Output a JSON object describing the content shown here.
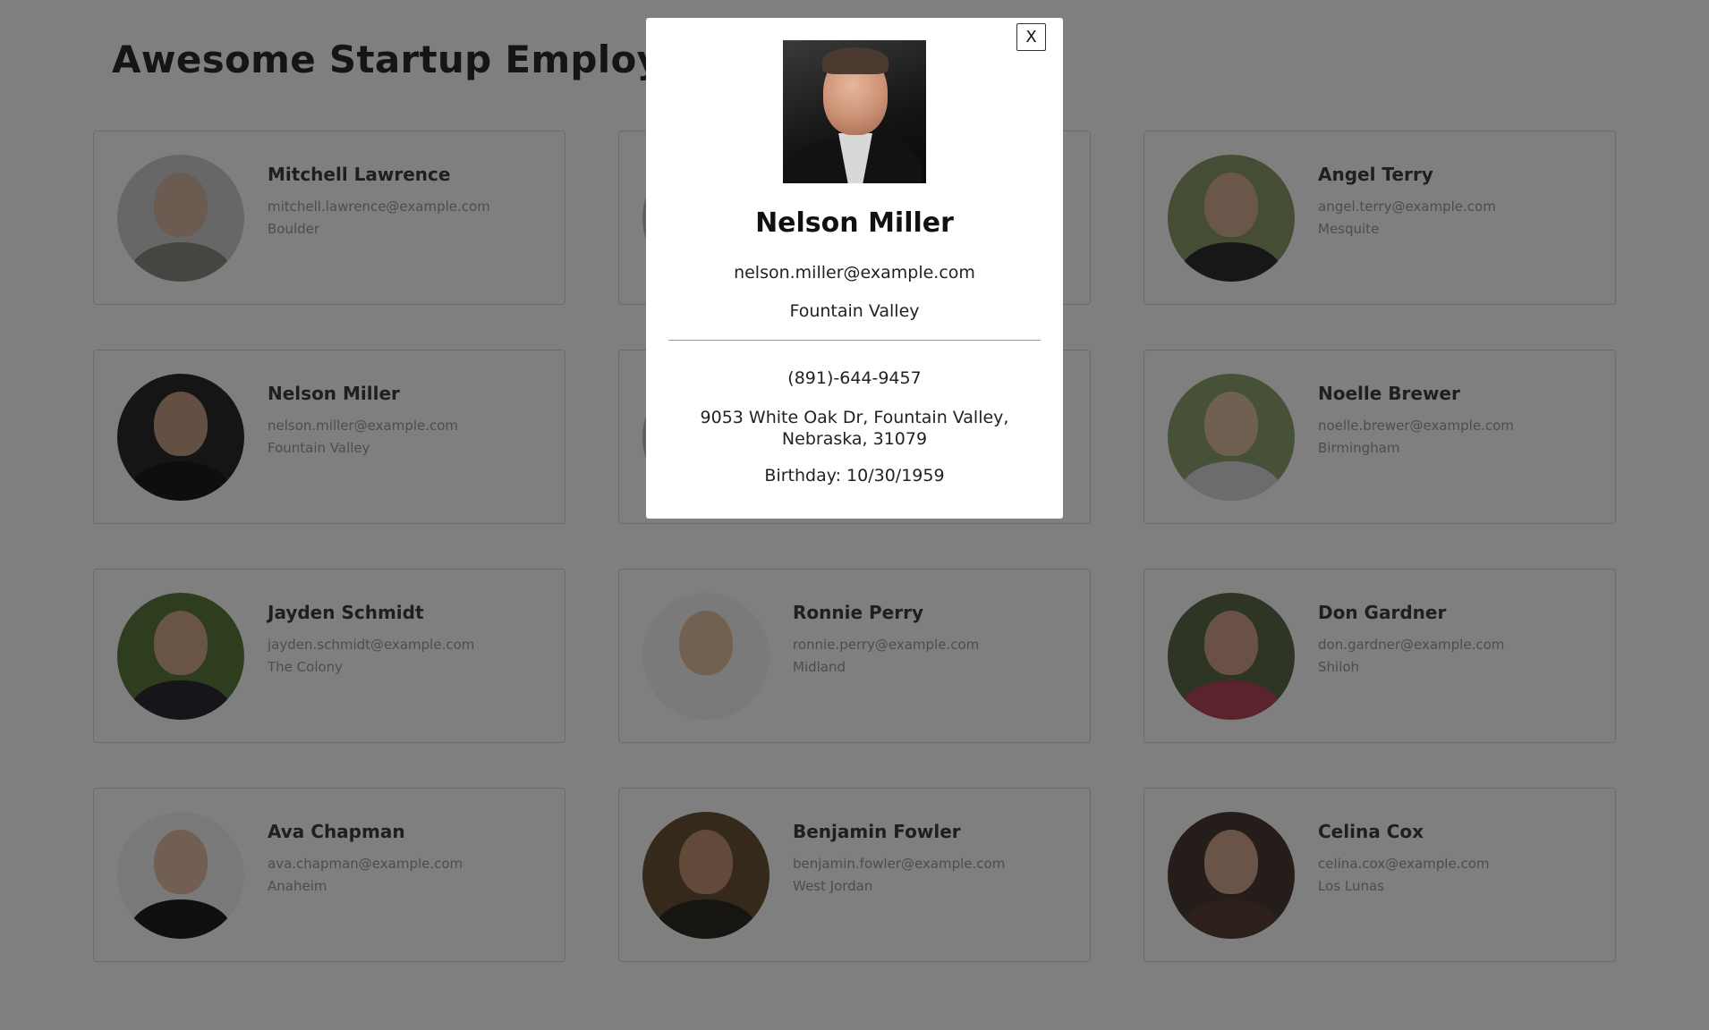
{
  "page": {
    "title": "Awesome Startup Employee Directory"
  },
  "employees": [
    {
      "name": "Mitchell Lawrence",
      "email": "mitchell.lawrence@example.com",
      "city": "Boulder",
      "skin": "#d6b5a0",
      "clothes": "#8a8a84",
      "bg": "#cfcfcf"
    },
    {
      "name": "",
      "email": "",
      "city": "",
      "skin": "#c9a48a",
      "clothes": "#555555",
      "bg": "#bdbdbd"
    },
    {
      "name": "Angel Terry",
      "email": "angel.terry@example.com",
      "city": "Mesquite",
      "skin": "#d9b097",
      "clothes": "#2f2f2f",
      "bg": "#8a9a6a"
    },
    {
      "name": "Nelson Miller",
      "email": "nelson.miller@example.com",
      "city": "Fountain Valley",
      "skin": "#d2a58c",
      "clothes": "#1c1c1c",
      "bg": "#2a2a2a"
    },
    {
      "name": "",
      "email": "",
      "city": "",
      "skin": "#c9a48a",
      "clothes": "#555555",
      "bg": "#bdbdbd"
    },
    {
      "name": "Noelle Brewer",
      "email": "noelle.brewer@example.com",
      "city": "Birmingham",
      "skin": "#e6c3a8",
      "clothes": "#d8d8d8",
      "bg": "#8ea26e"
    },
    {
      "name": "Jayden Schmidt",
      "email": "jayden.schmidt@example.com",
      "city": "The Colony",
      "skin": "#d8ab8e",
      "clothes": "#2a2a34",
      "bg": "#5e7a3e"
    },
    {
      "name": "Ronnie Perry",
      "email": "ronnie.perry@example.com",
      "city": "Midland",
      "skin": "#e4bf9e",
      "clothes": "#f2f2f2",
      "bg": "#f4f4f4"
    },
    {
      "name": "Don Gardner",
      "email": "don.gardner@example.com",
      "city": "Shiloh",
      "skin": "#d9a88e",
      "clothes": "#b5475a",
      "bg": "#5c6b4a"
    },
    {
      "name": "Ava Chapman",
      "email": "ava.chapman@example.com",
      "city": "Anaheim",
      "skin": "#e3b8a0",
      "clothes": "#1e1e1e",
      "bg": "#f3f3f3"
    },
    {
      "name": "Benjamin Fowler",
      "email": "benjamin.fowler@example.com",
      "city": "West Jordan",
      "skin": "#c99676",
      "clothes": "#2e2a22",
      "bg": "#6a5236"
    },
    {
      "name": "Celina Cox",
      "email": "celina.cox@example.com",
      "city": "Los Lunas",
      "skin": "#dcae94",
      "clothes": "#5a4034",
      "bg": "#4a3a34"
    }
  ],
  "modal": {
    "close_label": "X",
    "name": "Nelson Miller",
    "email": "nelson.miller@example.com",
    "city": "Fountain Valley",
    "phone": "(891)-644-9457",
    "address": "9053 White Oak Dr, Fountain Valley, Nebraska, 31079",
    "birthday": "Birthday: 10/30/1959"
  }
}
